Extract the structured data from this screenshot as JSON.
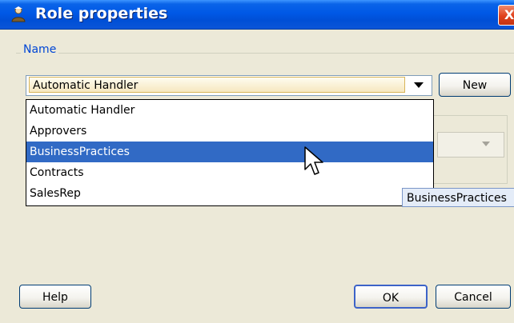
{
  "window": {
    "title": "Role properties",
    "close_glyph": "X"
  },
  "name_group": {
    "label": "Name",
    "combo_value": "Automatic Handler",
    "new_label": "New",
    "dropdown_items": [
      {
        "label": "Automatic Handler",
        "selected": false
      },
      {
        "label": "Approvers",
        "selected": false
      },
      {
        "label": "BusinessPractices",
        "selected": true
      },
      {
        "label": "Contracts",
        "selected": false
      },
      {
        "label": "SalesRep",
        "selected": false
      }
    ],
    "tooltip": "BusinessPractices"
  },
  "footer": {
    "help_label": "Help",
    "ok_label": "OK",
    "cancel_label": "Cancel"
  },
  "icons": {
    "title": "role-user-icon",
    "combo_arrow": "chevron-down-icon",
    "cursor": "mouse-pointer-icon"
  },
  "colors": {
    "titlebar": "#0058e6",
    "group_label": "#0046d5",
    "selection": "#316ac5",
    "close": "#e0411b"
  }
}
